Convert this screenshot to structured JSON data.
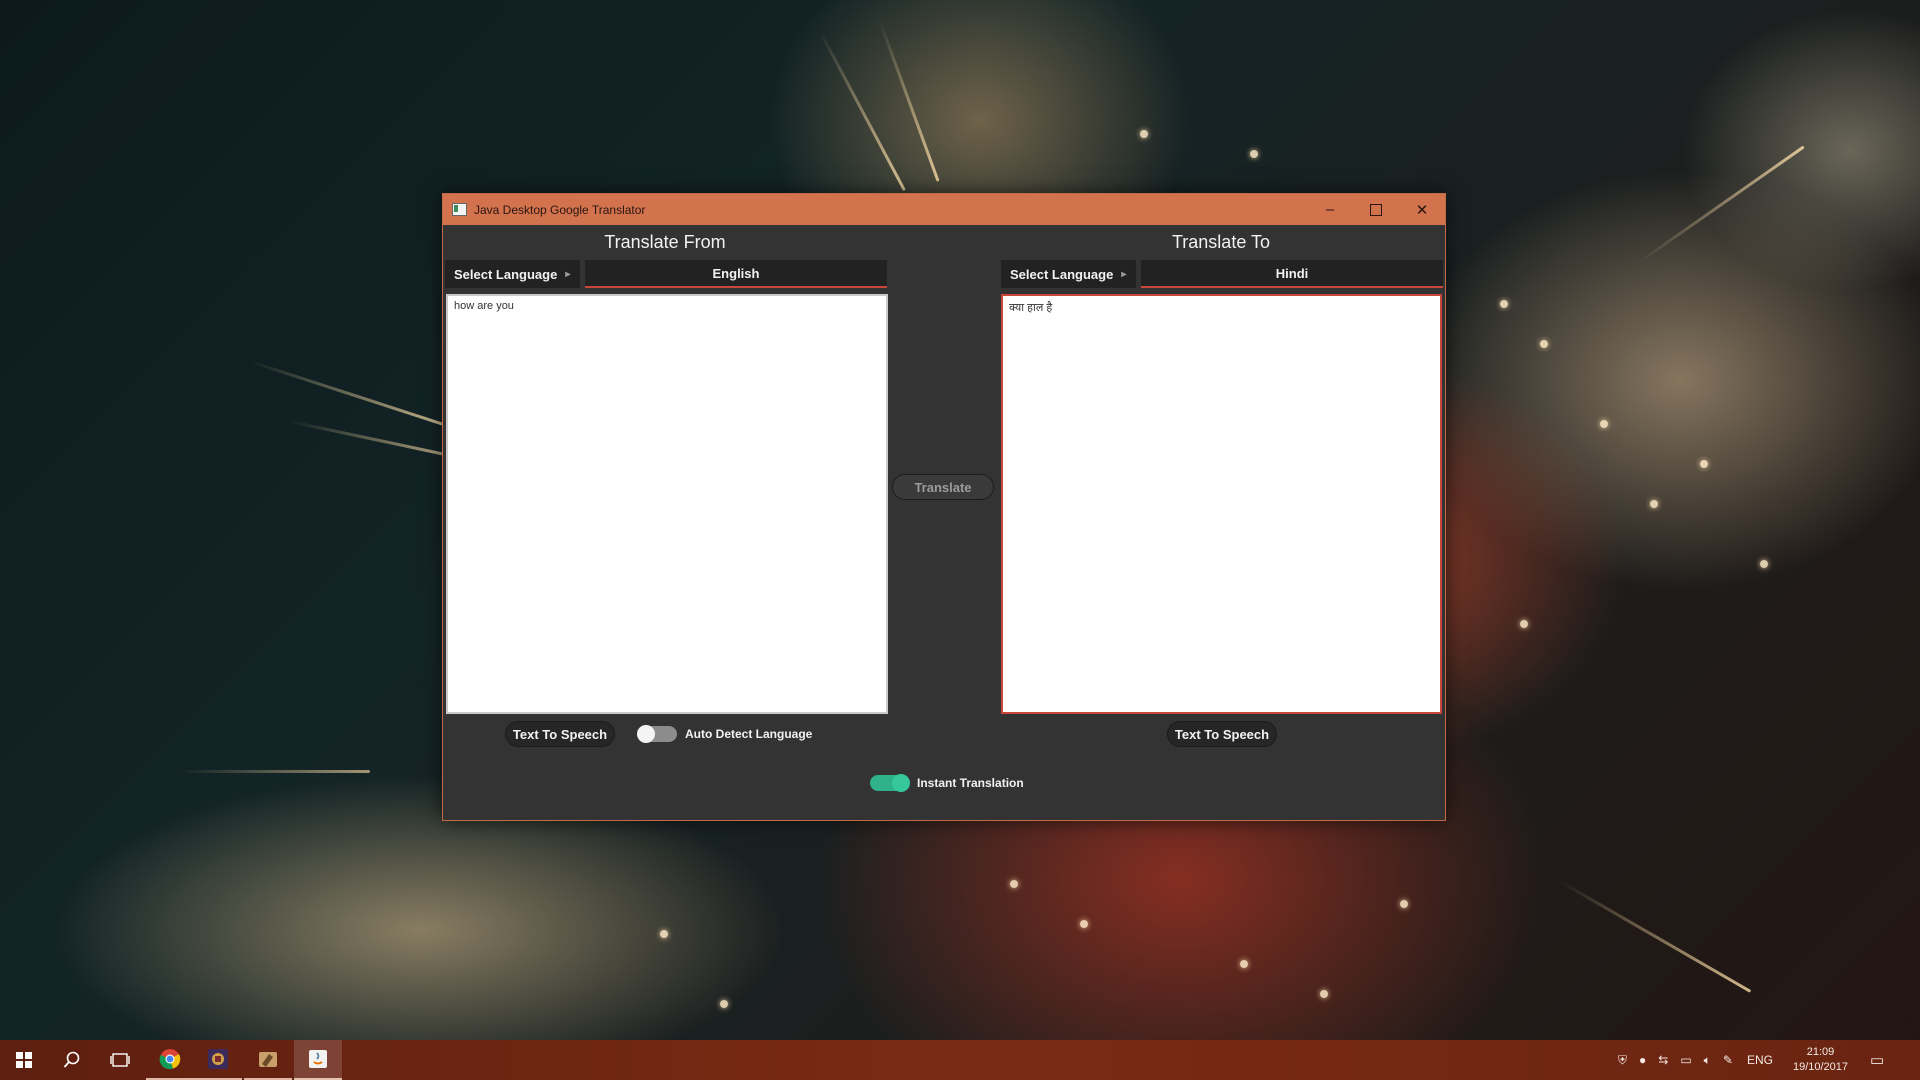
{
  "window": {
    "title": "Java Desktop Google Translator",
    "minimize": "–",
    "close": "✕"
  },
  "left": {
    "heading": "Translate From",
    "select_label": "Select Language",
    "arrow": "▸",
    "language": "English",
    "text": "how are you",
    "tts_label": "Text To Speech",
    "auto_detect_label": "Auto Detect Language",
    "auto_detect_on": false
  },
  "right": {
    "heading": "Translate To",
    "select_label": "Select Language",
    "arrow": "▸",
    "language": "Hindi",
    "text": "क्या हाल है",
    "tts_label": "Text To Speech"
  },
  "translate_label": "Translate",
  "instant": {
    "label": "Instant Translation",
    "on": true
  },
  "colors": {
    "titlebar": "#d2734e",
    "toggle_on": "#2fb28a",
    "toggle_off": "#8c8c8c",
    "accent_underline": "#c9473a"
  },
  "taskbar": {
    "apps": [
      "windows-start",
      "search",
      "task-view",
      "chrome",
      "app-game",
      "app-tools",
      "java-app"
    ],
    "tray": {
      "language": "ENG",
      "time": "21:09",
      "date": "19/10/2017"
    }
  }
}
